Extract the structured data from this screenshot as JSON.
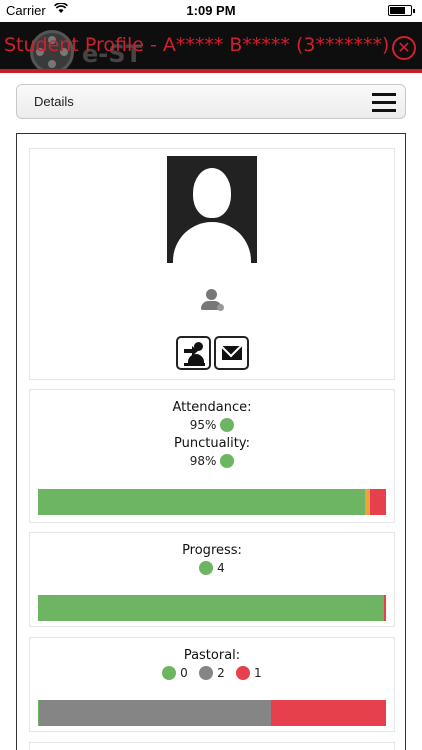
{
  "status_bar": {
    "carrier": "Carrier",
    "time": "1:09 PM"
  },
  "header": {
    "logo_text": "e-ST",
    "title": "Student Profile - A***** B***** (3*******)",
    "close_icon": "close-icon",
    "accent_color": "#c21f2a"
  },
  "details_bar": {
    "label": "Details",
    "menu_icon": "hamburger-menu-icon"
  },
  "profile": {
    "photo": "user-silhouette",
    "user_icon": "user-icon",
    "actions": [
      {
        "icon": "login-as-user-icon"
      },
      {
        "icon": "envelope-icon"
      }
    ]
  },
  "attendance": {
    "label": "Attendance:",
    "value": "95%",
    "status_color": "#6db562",
    "punctuality_label": "Punctuality:",
    "punctuality_value": "98%",
    "punctuality_color": "#6db562",
    "bar_fractions": {
      "green": 0.94,
      "orange": 0.015,
      "red": 0.045
    }
  },
  "progress": {
    "label": "Progress:",
    "value": "4",
    "status_color": "#6db562",
    "bar_fractions": {
      "green": 0.995,
      "red": 0.005
    }
  },
  "pastoral": {
    "label": "Pastoral:",
    "items": [
      {
        "color": "#6db562",
        "count": "0"
      },
      {
        "color": "#858585",
        "count": "2"
      },
      {
        "color": "#e5404b",
        "count": "1"
      }
    ],
    "bar_fractions": {
      "green": 0.003,
      "grey": 0.667,
      "red": 0.33
    }
  }
}
